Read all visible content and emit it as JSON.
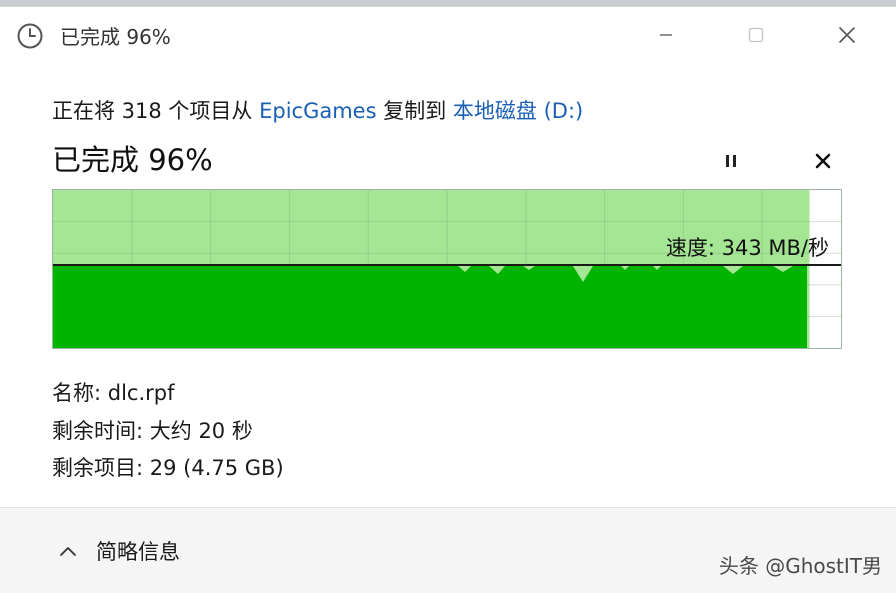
{
  "window": {
    "title": "已完成 96%"
  },
  "copy": {
    "line_prefix": "正在将 318 个项目从 ",
    "source": "EpicGames",
    "line_middle": " 复制到 ",
    "destination": "本地磁盘 (D:)",
    "status": "已完成 96%",
    "progress_percent": 96
  },
  "chart": {
    "speed_label": "速度: 343 MB/秒",
    "fill_color": "#00b400",
    "area_color": "#a5e695"
  },
  "details": {
    "name_label": "名称:",
    "name_value": "dlc.rpf",
    "time_label": "剩余时间:",
    "time_value": "大约 20 秒",
    "items_label": "剩余项目:",
    "items_value": "29 (4.75 GB)"
  },
  "footer": {
    "toggle_label": "简略信息",
    "watermark": "头条 @GhostIT男"
  }
}
